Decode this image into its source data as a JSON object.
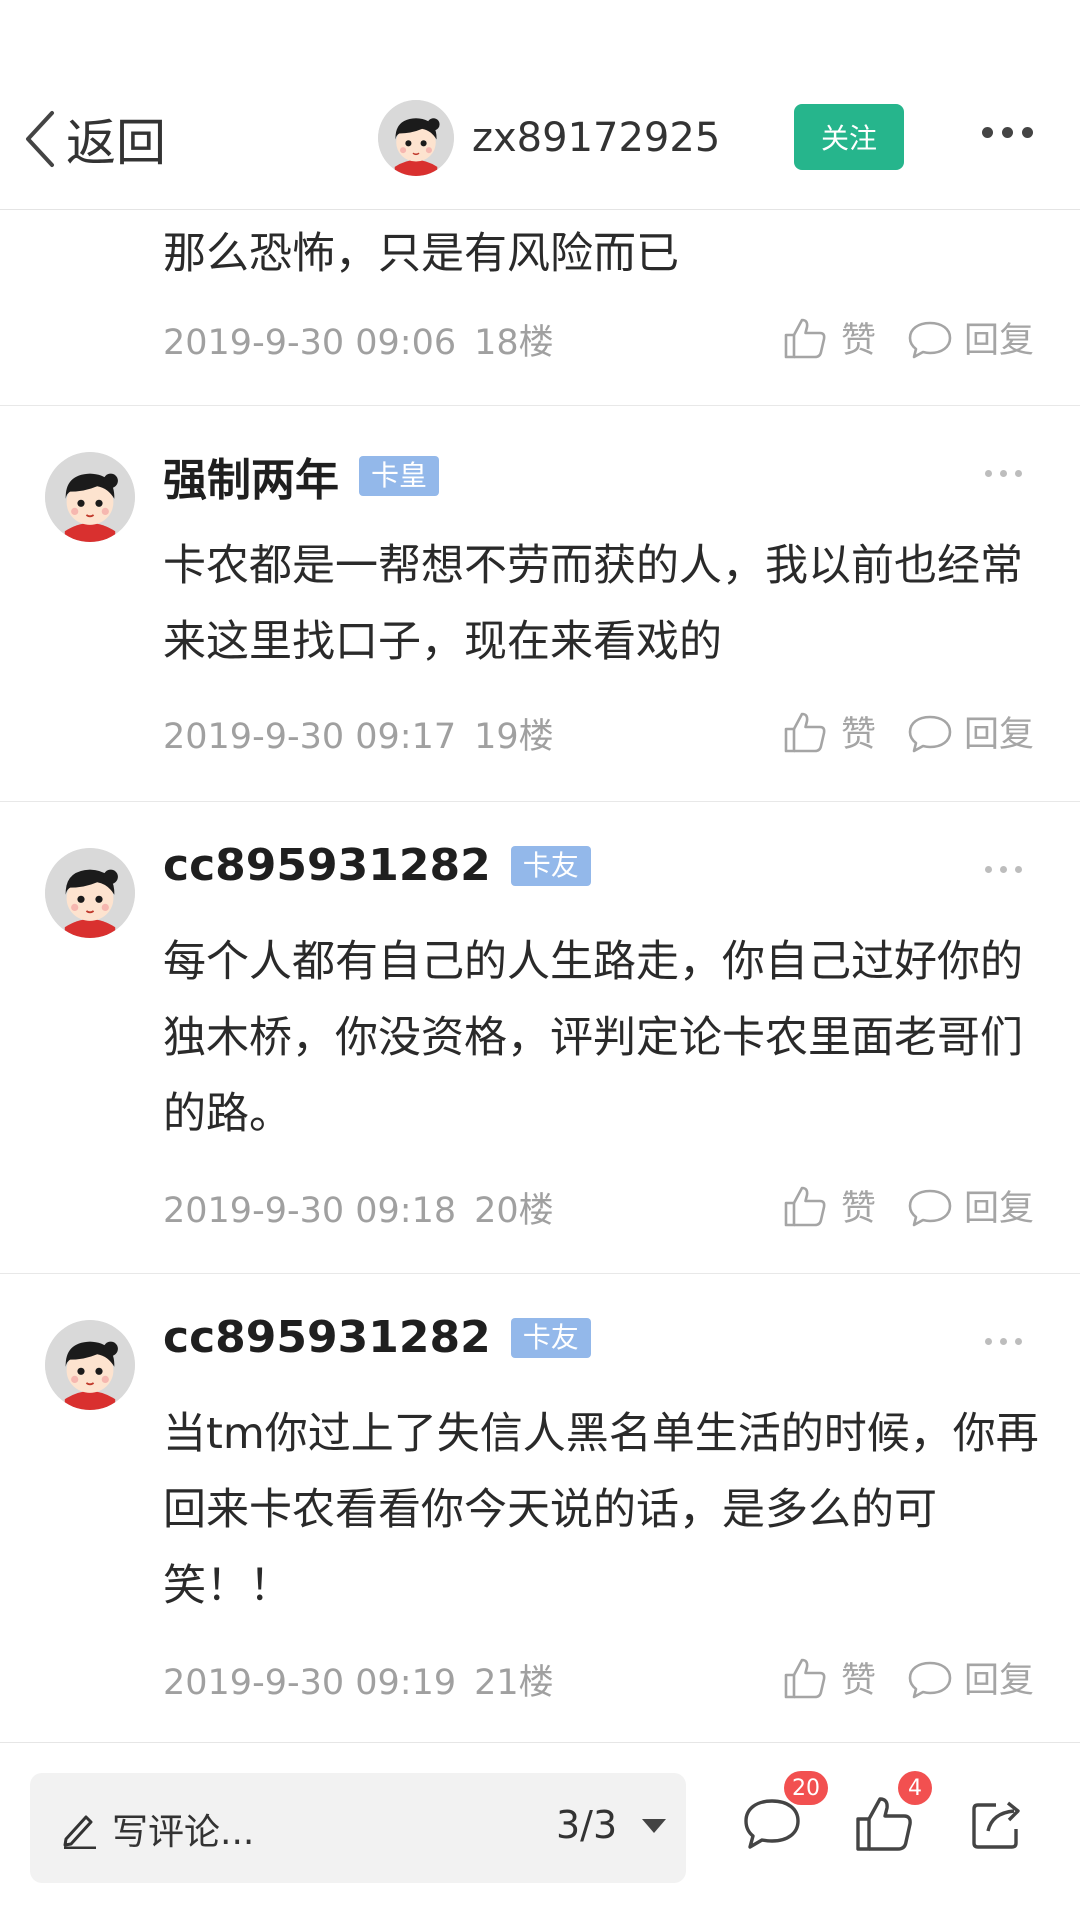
{
  "header": {
    "back_label": "返回",
    "username": "zx89172925",
    "follow_label": "关注"
  },
  "partial_comment": {
    "text": "那么恐怖，只是有风险而已",
    "time": "2019-9-30 09:06",
    "floor": "18楼",
    "like_label": "赞",
    "reply_label": "回复"
  },
  "comments": [
    {
      "name": "强制两年",
      "badge": "卡皇",
      "text": "卡农都是一帮想不劳而获的人，我以前也经常来这里找口子，现在来看戏的",
      "time": "2019-9-30 09:17",
      "floor": "19楼",
      "like_label": "赞",
      "reply_label": "回复"
    },
    {
      "name": "cc895931282",
      "badge": "卡友",
      "text": "每个人都有自己的人生路走，你自己过好你的独木桥，你没资格，评判定论卡农里面老哥们的路。",
      "time": "2019-9-30 09:18",
      "floor": "20楼",
      "like_label": "赞",
      "reply_label": "回复"
    },
    {
      "name": "cc895931282",
      "badge": "卡友",
      "text": "当tm你过上了失信人黑名单生活的时候，你再回来卡农看看你今天说的话，是多么的可笑！！",
      "time": "2019-9-30 09:19",
      "floor": "21楼",
      "like_label": "赞",
      "reply_label": "回复"
    }
  ],
  "bottom_bar": {
    "comment_placeholder": "写评论...",
    "page_indicator": "3/3",
    "comment_count": "20",
    "like_count": "4"
  },
  "colors": {
    "follow_button": "#26b58c",
    "badge": "#93b8ea",
    "count_badge": "#f25050"
  },
  "icons": [
    "back-chevron-icon",
    "more-icon",
    "thumbs-up-icon",
    "speech-bubble-icon",
    "pencil-icon",
    "dropdown-caret-icon",
    "share-icon"
  ]
}
